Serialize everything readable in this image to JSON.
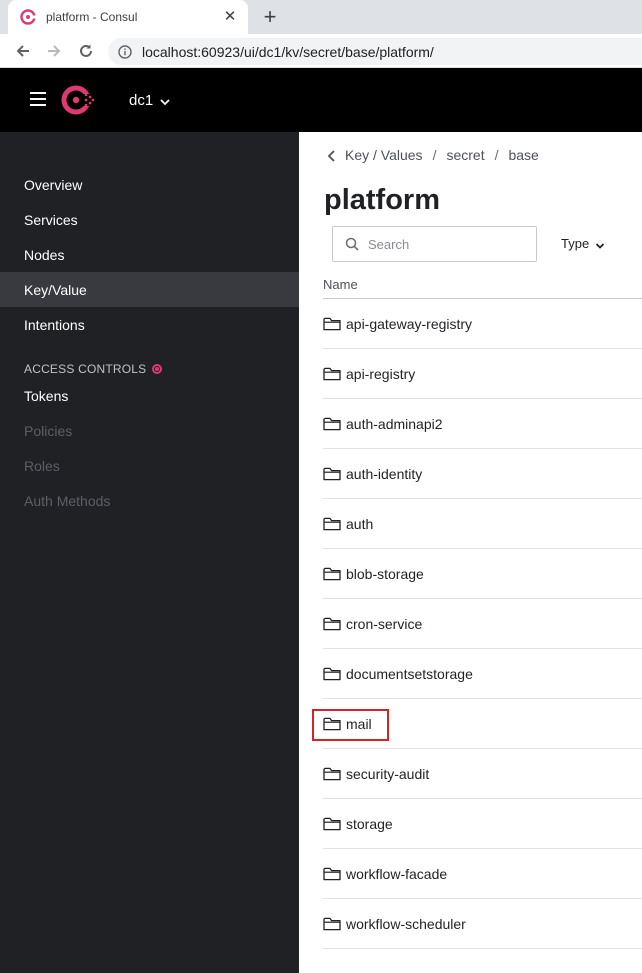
{
  "browser": {
    "tab_title": "platform - Consul",
    "new_tab_label": "+",
    "close_label": "✕",
    "url": "localhost:60923/ui/dc1/kv/secret/base/platform/"
  },
  "header": {
    "datacenter": "dc1",
    "brand_color": "#e03875"
  },
  "sidebar": {
    "items": [
      {
        "label": "Overview"
      },
      {
        "label": "Services"
      },
      {
        "label": "Nodes"
      },
      {
        "label": "Key/Value"
      },
      {
        "label": "Intentions"
      }
    ],
    "section_title": "ACCESS CONTROLS",
    "acl_items": [
      {
        "label": "Tokens"
      },
      {
        "label": "Policies"
      },
      {
        "label": "Roles"
      },
      {
        "label": "Auth Methods"
      }
    ]
  },
  "main": {
    "breadcrumbs": [
      "Key / Values",
      "secret",
      "base"
    ],
    "crumb_sep": "/",
    "title": "platform",
    "search_placeholder": "Search",
    "type_filter": "Type",
    "column_name": "Name",
    "rows": [
      {
        "label": "api-gateway-registry"
      },
      {
        "label": "api-registry"
      },
      {
        "label": "auth-adminapi2"
      },
      {
        "label": "auth-identity"
      },
      {
        "label": "auth"
      },
      {
        "label": "blob-storage"
      },
      {
        "label": "cron-service"
      },
      {
        "label": "documentsetstorage"
      },
      {
        "label": "mail"
      },
      {
        "label": "security-audit"
      },
      {
        "label": "storage"
      },
      {
        "label": "workflow-facade"
      },
      {
        "label": "workflow-scheduler"
      }
    ],
    "highlighted_row": "mail"
  }
}
